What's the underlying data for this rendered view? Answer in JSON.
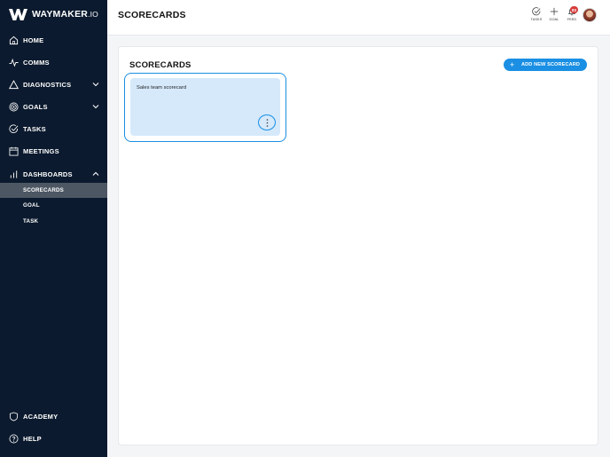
{
  "brand": {
    "name": "WAYMAKER",
    "suffix": ".IO"
  },
  "header": {
    "title": "SCORECARDS",
    "actions": [
      {
        "label": "TASKS",
        "icon": "check-circle-icon"
      },
      {
        "label": "GOAL",
        "icon": "plus-icon"
      },
      {
        "label": "FEED",
        "icon": "bell-icon"
      }
    ],
    "feed_badge": "83"
  },
  "sidebar": {
    "items": [
      {
        "label": "HOME",
        "icon": "home-icon"
      },
      {
        "label": "COMMS",
        "icon": "pulse-icon"
      },
      {
        "label": "DIAGNOSTICS",
        "icon": "warning-triangle-icon",
        "chevron": "down"
      },
      {
        "label": "GOALS",
        "icon": "target-icon",
        "chevron": "down"
      },
      {
        "label": "TASKS",
        "icon": "check-circle-icon"
      },
      {
        "label": "MEETINGS",
        "icon": "calendar-icon"
      },
      {
        "label": "DASHBOARDS",
        "icon": "bar-chart-icon",
        "chevron": "up"
      }
    ],
    "dashboards_sub": [
      {
        "label": "SCORECARDS",
        "active": true
      },
      {
        "label": "GOAL",
        "active": false
      },
      {
        "label": "TASK",
        "active": false
      }
    ],
    "bottom": [
      {
        "label": "ACADEMY",
        "icon": "shield-icon"
      },
      {
        "label": "HELP",
        "icon": "help-circle-icon"
      }
    ]
  },
  "main": {
    "title": "SCORECARDS",
    "add_button": "ADD NEW SCORECARD",
    "cards": [
      {
        "title": "Sales team scorecard"
      }
    ]
  },
  "colors": {
    "sidebar_bg": "#0b1a2e",
    "accent": "#1a8fe3",
    "card_bg": "#d5e9fb",
    "active_sub_bg": "#4d5763",
    "badge": "#d63a3a"
  }
}
